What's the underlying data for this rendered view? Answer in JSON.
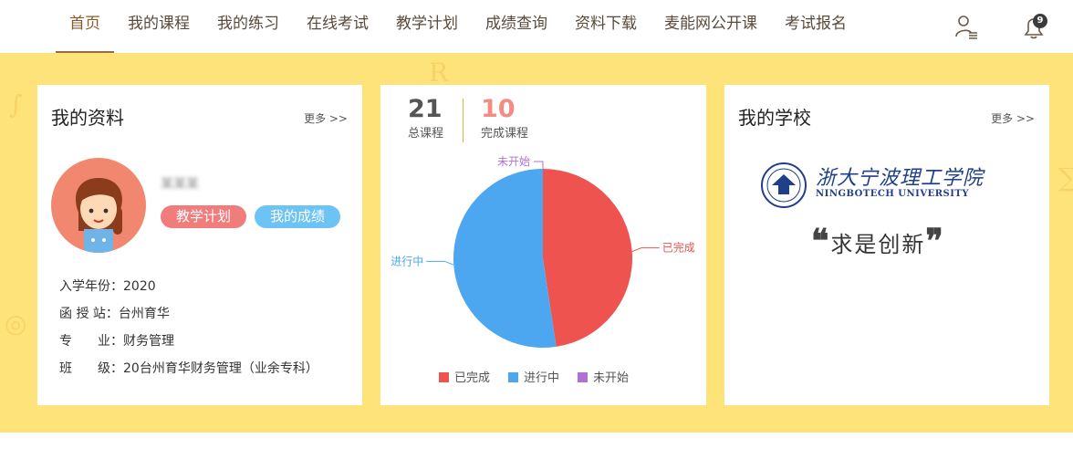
{
  "nav": {
    "items": [
      {
        "label": "首页",
        "active": true
      },
      {
        "label": "我的课程"
      },
      {
        "label": "我的练习"
      },
      {
        "label": "在线考试"
      },
      {
        "label": "教学计划"
      },
      {
        "label": "成绩查询"
      },
      {
        "label": "资料下载"
      },
      {
        "label": "麦能网公开课"
      },
      {
        "label": "考试报名"
      }
    ],
    "user_icon": "user-list-icon",
    "bell_icon": "bell-icon",
    "notification_count": "9"
  },
  "profile": {
    "title": "我的资料",
    "more": "更多 >>",
    "username": "某某某",
    "plan_button": "教学计划",
    "score_button": "我的成绩",
    "rows": [
      {
        "label": "入学年份",
        "value": "2020"
      },
      {
        "label": "函 授 站",
        "value": "台州育华"
      },
      {
        "label": "专　　业",
        "value": "财务管理"
      },
      {
        "label": "班　　级",
        "value": "20台州育华财务管理（业余专科）"
      }
    ]
  },
  "courses": {
    "total_count": "21",
    "total_label": "总课程",
    "done_count": "10",
    "done_label": "完成课程"
  },
  "chart_data": {
    "type": "pie",
    "slices": [
      {
        "name": "已完成",
        "value": 10,
        "color": "#ef5350"
      },
      {
        "name": "进行中",
        "value": 11,
        "color": "#4da7f0"
      },
      {
        "name": "未开始",
        "value": 0,
        "color": "#b171d4"
      }
    ],
    "legend": [
      "已完成",
      "进行中",
      "未开始"
    ],
    "legend_position": "bottom"
  },
  "school": {
    "title": "我的学校",
    "more": "更多 >>",
    "name_cn": "浙大宁波理工学院",
    "name_en": "NINGBOTECH UNIVERSITY",
    "motto": "求是创新"
  },
  "colors": {
    "banner": "#fde37a",
    "accent": "#9b6a3c"
  }
}
